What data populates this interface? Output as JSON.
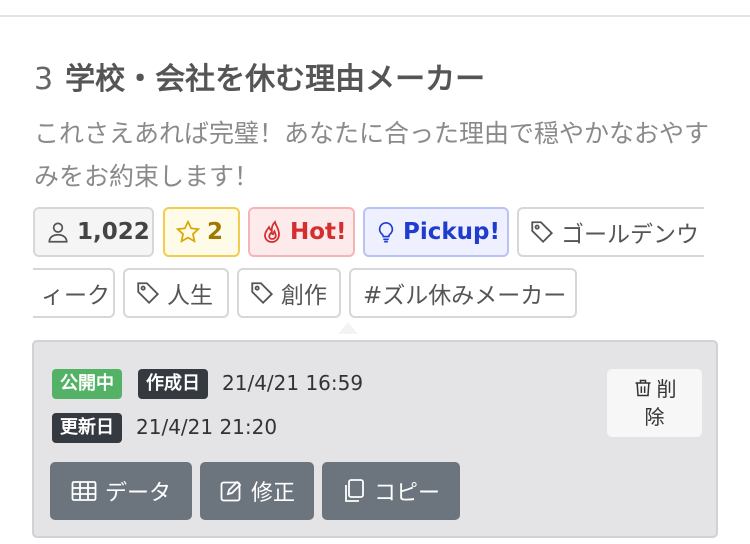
{
  "item": {
    "rank": "3",
    "title": "学校・会社を休む理由メーカー",
    "description": "これさえあれば完璧！あなたに合った理由で穏やかなおやすみをお約束します！"
  },
  "stats": {
    "views": "1,022",
    "stars": "2",
    "hot_label": "Hot!",
    "pickup_label": "Pickup!"
  },
  "tags": [
    {
      "label_part1": "ゴールデンウ",
      "label_part2": "ィーク"
    },
    {
      "label": "人生"
    },
    {
      "label": "創作"
    },
    {
      "label": "#ズル休みメーカー"
    }
  ],
  "meta": {
    "public_badge": "公開中",
    "created_badge": "作成日",
    "created_at": "21/4/21 16:59",
    "updated_badge": "更新日",
    "updated_at": "21/4/21 21:20",
    "delete_label_1": "削",
    "delete_label_2": "除"
  },
  "actions": {
    "data_label": "データ",
    "edit_label": "修正",
    "copy_label": "コピー"
  },
  "colors": {
    "public": "#53b266",
    "dark_badge": "#343a40",
    "button": "#6c757d",
    "hot": "#d42f2f",
    "pickup": "#1f3ccf",
    "star": "#f2cc4d"
  }
}
